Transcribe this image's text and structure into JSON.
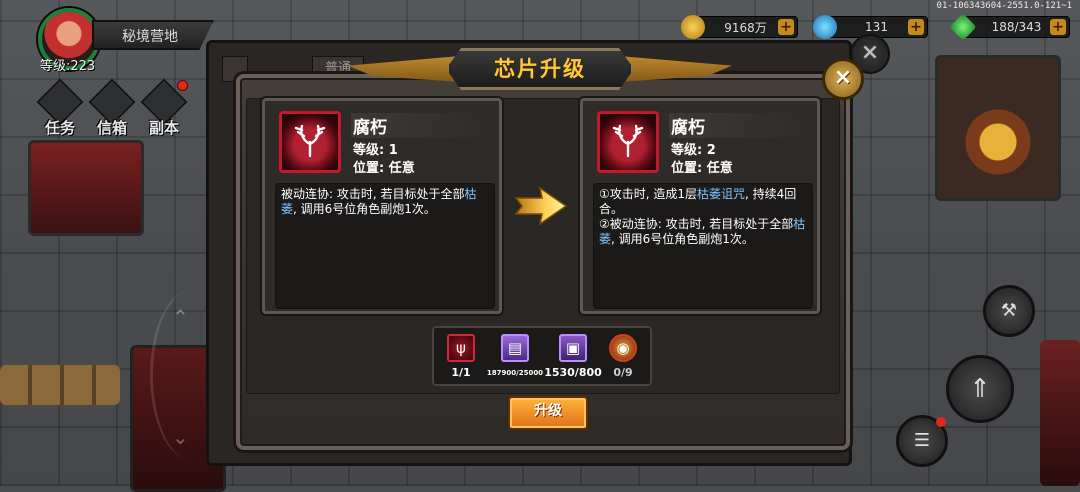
{
  "hud": {
    "camp_name": "秘境营地",
    "level": "等级:223",
    "menu": [
      {
        "label": "任务",
        "badge": false
      },
      {
        "label": "信箱",
        "badge": false
      },
      {
        "label": "副本",
        "badge": true
      }
    ],
    "resources": {
      "gold": "9168万",
      "gem": "131",
      "energy": "188/343",
      "plus": "+"
    },
    "server_info": "01-106343604-2551.0-121~1"
  },
  "background_tabs": [
    "",
    "普通"
  ],
  "dialog": {
    "title": "芯片升级",
    "close": "×",
    "current_chip": {
      "icon": "antler-icon",
      "name": "腐朽",
      "level": "等级: 1",
      "position": "位置: 任意",
      "desc_parts": [
        "被动连协: 攻击时, 若目标处于全部",
        "枯萎",
        ", 调用6号位角色副炮1次。"
      ]
    },
    "next_chip": {
      "icon": "antler-icon",
      "name": "腐朽",
      "level": "等级: 2",
      "position": "位置: 任意",
      "desc_parts": [
        "①攻击时, 造成1层",
        "枯萎诅咒",
        ", 持续4回合。",
        "②被动连协: 攻击时, 若目标处于全部",
        "枯萎",
        ", 调用6号位角色副炮1次。"
      ]
    },
    "materials": [
      {
        "icon": "chip-icon",
        "count": "1/1"
      },
      {
        "icon": "book-icon",
        "count": "187900/25000"
      },
      {
        "icon": "box-icon",
        "count": "1530/800"
      },
      {
        "icon": "orb-icon",
        "count": "0/9"
      }
    ],
    "upgrade_label": "升级"
  },
  "colors": {
    "title": "#ffc93a",
    "highlight": "#7cc4ff",
    "chip_red": "#c21a2a",
    "button": "#f08a22"
  }
}
